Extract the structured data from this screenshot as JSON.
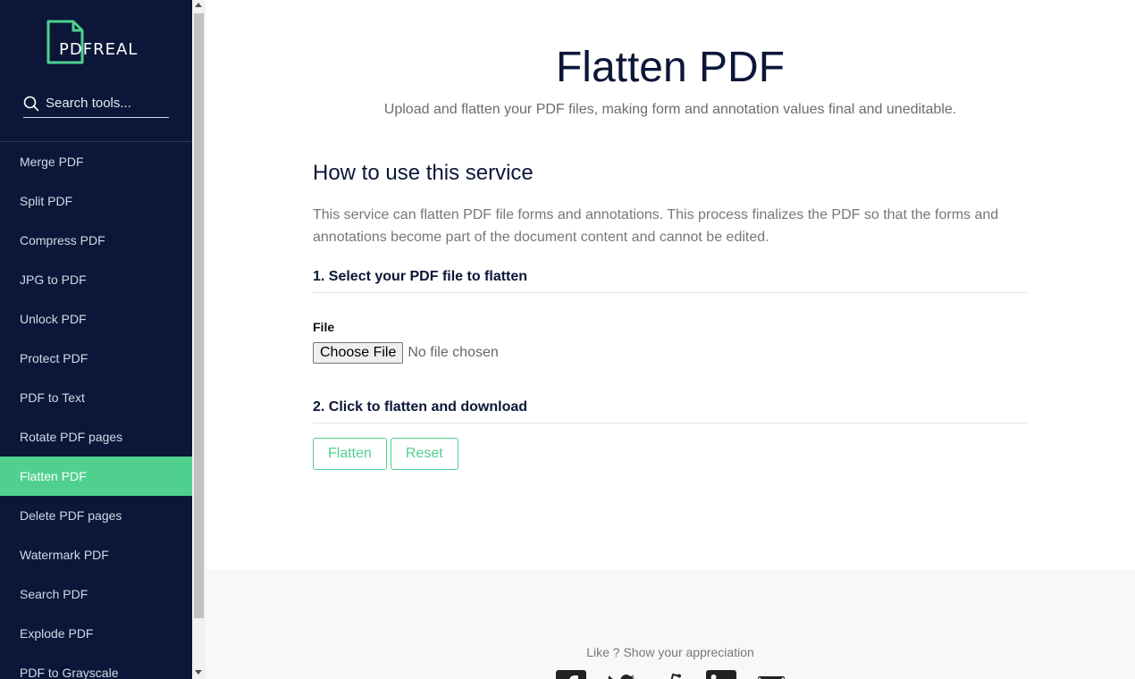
{
  "sidebar": {
    "logo_text": "PDFREAL",
    "search_placeholder": "Search tools...",
    "items": [
      {
        "label": "Merge PDF"
      },
      {
        "label": "Split PDF"
      },
      {
        "label": "Compress PDF"
      },
      {
        "label": "JPG to PDF"
      },
      {
        "label": "Unlock PDF"
      },
      {
        "label": "Protect PDF"
      },
      {
        "label": "PDF to Text"
      },
      {
        "label": "Rotate PDF pages"
      },
      {
        "label": "Flatten PDF",
        "active": true
      },
      {
        "label": "Delete PDF pages"
      },
      {
        "label": "Watermark PDF"
      },
      {
        "label": "Search PDF"
      },
      {
        "label": "Explode PDF"
      },
      {
        "label": "PDF to Grayscale"
      }
    ]
  },
  "main": {
    "title": "Flatten PDF",
    "subtitle": "Upload and flatten your PDF files, making form and annotation values final and uneditable.",
    "how_title": "How to use this service",
    "description": "This service can flatten PDF file forms and annotations. This process finalizes the PDF so that the forms and annotations become part of the document content and cannot be edited.",
    "step1_title": "1. Select your PDF file to flatten",
    "file_label": "File",
    "choose_file_label": "Choose File",
    "no_file_text": "No file chosen",
    "step2_title": "2. Click to flatten and download",
    "flatten_label": "Flatten",
    "reset_label": "Reset"
  },
  "footer": {
    "appreciation_text": "Like ? Show your appreciation",
    "social_icons": [
      "facebook-icon",
      "twitter-icon",
      "reddit-icon",
      "linkedin-icon",
      "email-icon"
    ]
  },
  "colors": {
    "sidebar_bg": "#0b1638",
    "accent": "#4fd08e",
    "title": "#0b1638"
  }
}
